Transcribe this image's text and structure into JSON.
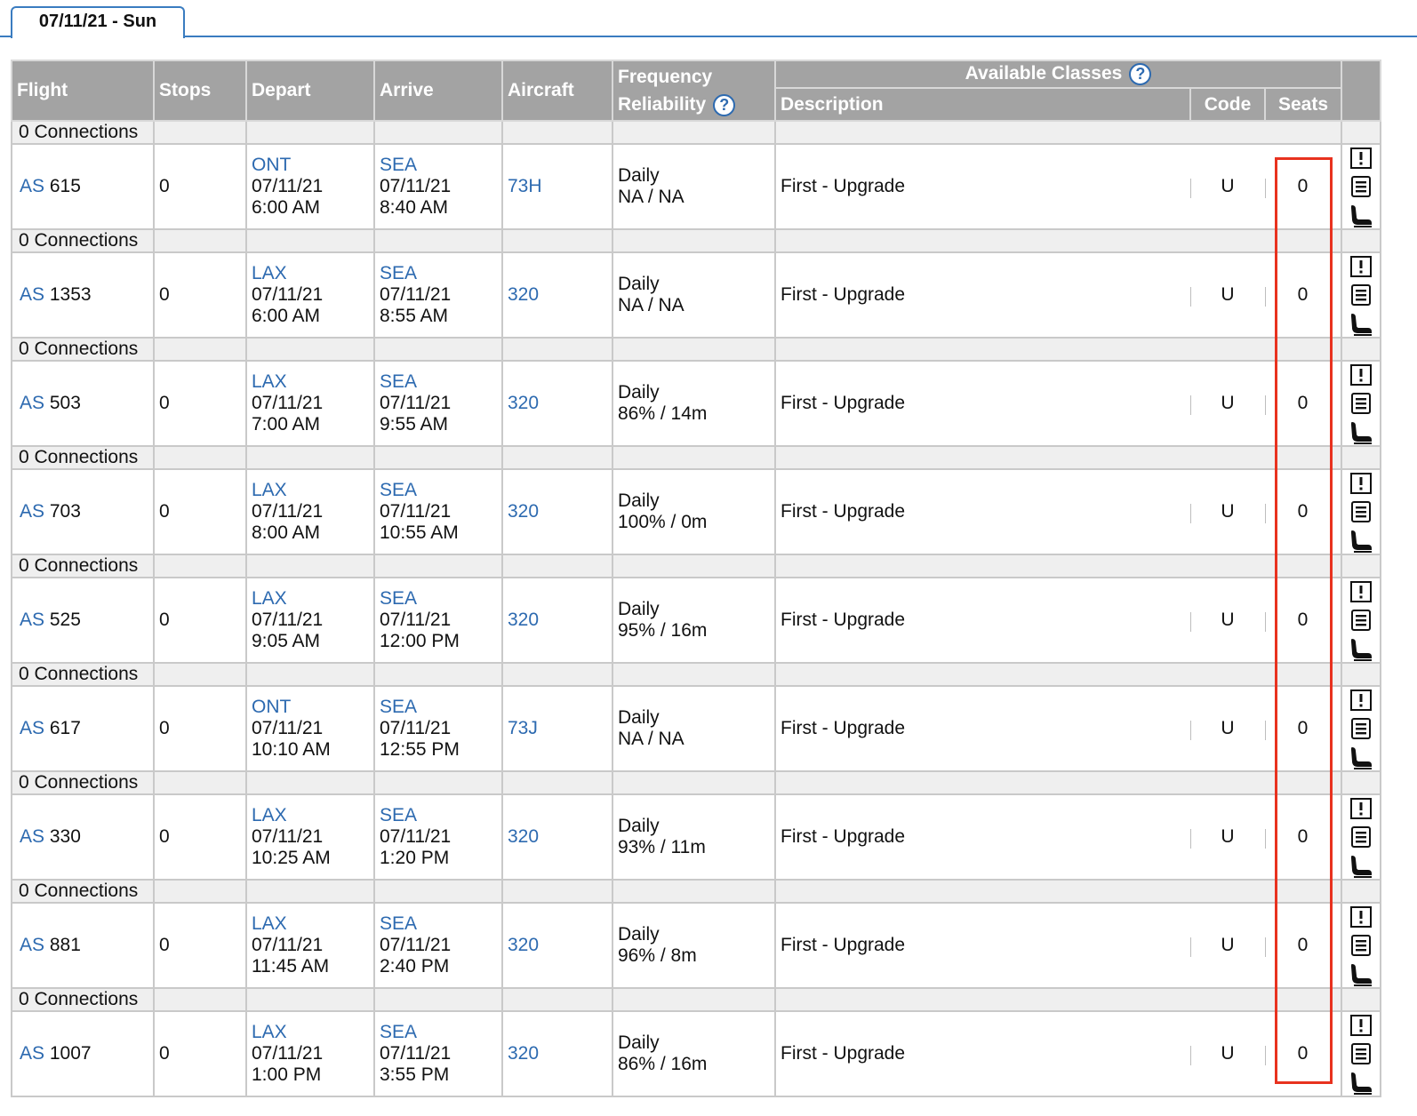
{
  "tab": {
    "label": "07/11/21 - Sun"
  },
  "headers": {
    "flight": "Flight",
    "stops": "Stops",
    "depart": "Depart",
    "arrive": "Arrive",
    "aircraft": "Aircraft",
    "frequency": "Frequency",
    "reliability": "Reliability",
    "available_classes": "Available Classes",
    "description": "Description",
    "code": "Code",
    "seats": "Seats"
  },
  "icons": {
    "help": "help-circle-icon",
    "alert": "alert-box-icon",
    "details": "details-list-icon",
    "seat": "seat-icon"
  },
  "colors": {
    "link": "#2d6ab0",
    "header_bg": "#a3a3a3",
    "highlight": "#e8321f"
  },
  "flights": [
    {
      "connections": "0 Connections",
      "carrier": "AS",
      "number": "615",
      "stops": "0",
      "dep_airport": "ONT",
      "dep_date": "07/11/21",
      "dep_time": "6:00 AM",
      "arr_airport": "SEA",
      "arr_date": "07/11/21",
      "arr_time": "8:40 AM",
      "aircraft": "73H",
      "frequency": "Daily",
      "reliability": "NA / NA",
      "description": "First - Upgrade",
      "code": "U",
      "seats": "0"
    },
    {
      "connections": "0 Connections",
      "carrier": "AS",
      "number": "1353",
      "stops": "0",
      "dep_airport": "LAX",
      "dep_date": "07/11/21",
      "dep_time": "6:00 AM",
      "arr_airport": "SEA",
      "arr_date": "07/11/21",
      "arr_time": "8:55 AM",
      "aircraft": "320",
      "frequency": "Daily",
      "reliability": "NA / NA",
      "description": "First - Upgrade",
      "code": "U",
      "seats": "0"
    },
    {
      "connections": "0 Connections",
      "carrier": "AS",
      "number": "503",
      "stops": "0",
      "dep_airport": "LAX",
      "dep_date": "07/11/21",
      "dep_time": "7:00 AM",
      "arr_airport": "SEA",
      "arr_date": "07/11/21",
      "arr_time": "9:55 AM",
      "aircraft": "320",
      "frequency": "Daily",
      "reliability": "86% / 14m",
      "description": "First - Upgrade",
      "code": "U",
      "seats": "0"
    },
    {
      "connections": "0 Connections",
      "carrier": "AS",
      "number": "703",
      "stops": "0",
      "dep_airport": "LAX",
      "dep_date": "07/11/21",
      "dep_time": "8:00 AM",
      "arr_airport": "SEA",
      "arr_date": "07/11/21",
      "arr_time": "10:55 AM",
      "aircraft": "320",
      "frequency": "Daily",
      "reliability": "100% / 0m",
      "description": "First - Upgrade",
      "code": "U",
      "seats": "0"
    },
    {
      "connections": "0 Connections",
      "carrier": "AS",
      "number": "525",
      "stops": "0",
      "dep_airport": "LAX",
      "dep_date": "07/11/21",
      "dep_time": "9:05 AM",
      "arr_airport": "SEA",
      "arr_date": "07/11/21",
      "arr_time": "12:00 PM",
      "aircraft": "320",
      "frequency": "Daily",
      "reliability": "95% / 16m",
      "description": "First - Upgrade",
      "code": "U",
      "seats": "0"
    },
    {
      "connections": "0 Connections",
      "carrier": "AS",
      "number": "617",
      "stops": "0",
      "dep_airport": "ONT",
      "dep_date": "07/11/21",
      "dep_time": "10:10 AM",
      "arr_airport": "SEA",
      "arr_date": "07/11/21",
      "arr_time": "12:55 PM",
      "aircraft": "73J",
      "frequency": "Daily",
      "reliability": "NA / NA",
      "description": "First - Upgrade",
      "code": "U",
      "seats": "0"
    },
    {
      "connections": "0 Connections",
      "carrier": "AS",
      "number": "330",
      "stops": "0",
      "dep_airport": "LAX",
      "dep_date": "07/11/21",
      "dep_time": "10:25 AM",
      "arr_airport": "SEA",
      "arr_date": "07/11/21",
      "arr_time": "1:20 PM",
      "aircraft": "320",
      "frequency": "Daily",
      "reliability": "93% / 11m",
      "description": "First - Upgrade",
      "code": "U",
      "seats": "0"
    },
    {
      "connections": "0 Connections",
      "carrier": "AS",
      "number": "881",
      "stops": "0",
      "dep_airport": "LAX",
      "dep_date": "07/11/21",
      "dep_time": "11:45 AM",
      "arr_airport": "SEA",
      "arr_date": "07/11/21",
      "arr_time": "2:40 PM",
      "aircraft": "320",
      "frequency": "Daily",
      "reliability": "96% / 8m",
      "description": "First - Upgrade",
      "code": "U",
      "seats": "0"
    },
    {
      "connections": "0 Connections",
      "carrier": "AS",
      "number": "1007",
      "stops": "0",
      "dep_airport": "LAX",
      "dep_date": "07/11/21",
      "dep_time": "1:00 PM",
      "arr_airport": "SEA",
      "arr_date": "07/11/21",
      "arr_time": "3:55 PM",
      "aircraft": "320",
      "frequency": "Daily",
      "reliability": "86% / 16m",
      "description": "First - Upgrade",
      "code": "U",
      "seats": "0"
    }
  ]
}
